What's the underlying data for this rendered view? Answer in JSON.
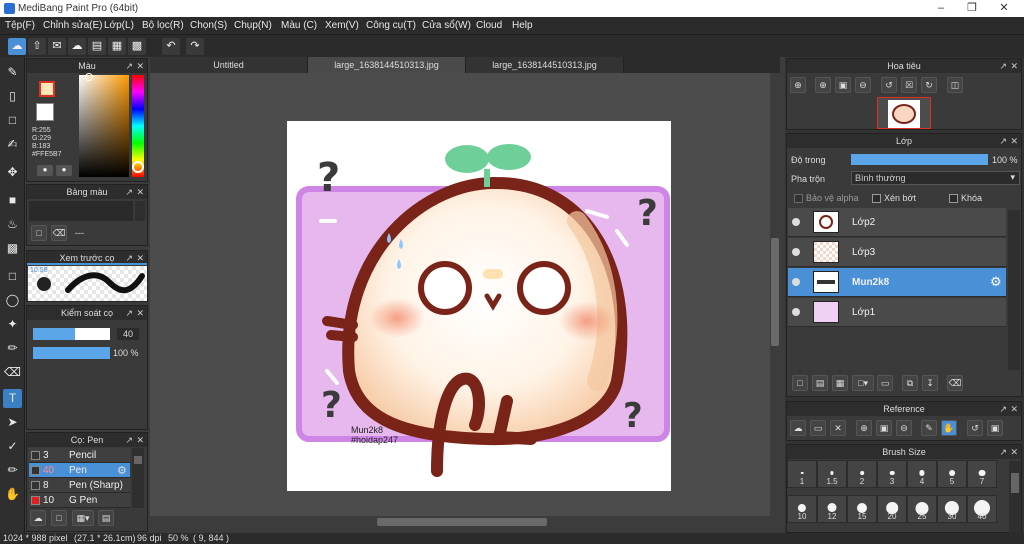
{
  "window": {
    "title": "MediBang Paint Pro (64bit)",
    "min_icon": "minimize-icon",
    "max_icon": "maximize-icon",
    "close_icon": "close-icon"
  },
  "menu": [
    "Tệp(F)",
    "Chỉnh sửa(E)",
    "Lớp(L)",
    "Bộ lọc(R)",
    "Chọn(S)",
    "Chụp(N)",
    "Màu (C)",
    "Xem(V)",
    "Công cụ(T)",
    "Cửa sổ(W)",
    "Cloud",
    "Help"
  ],
  "tabs": [
    {
      "label": "Untitled",
      "active": false
    },
    {
      "label": "large_1638144510313.jpg",
      "active": true
    },
    {
      "label": "large_1638144510313.jpg",
      "active": false
    }
  ],
  "color_panel": {
    "title": "Màu",
    "r": "R:255",
    "g": "G:229",
    "b": "B:183",
    "hex": "#FFE5B7",
    "fg_color": "#FFE5B7",
    "bg_color": "#FFFFFF"
  },
  "palette_panel": {
    "title": "Bảng màu",
    "dash": "---"
  },
  "brush_preview_panel": {
    "title": "Xem trước cọ",
    "size": "10.58"
  },
  "brush_control_panel": {
    "title": "Kiểm soát cọ",
    "size_value": "40",
    "opacity_value": "100 %",
    "size_fraction": 0.55,
    "opacity_fraction": 1.0
  },
  "brush_list_panel": {
    "title": "Cọ: Pen",
    "items": [
      {
        "num": "3",
        "name": "Pencil",
        "color": "#333333",
        "selected": false
      },
      {
        "num": "40",
        "name": "Pen",
        "color": "#333333",
        "selected": true
      },
      {
        "num": "8",
        "name": "Pen (Sharp)",
        "color": "#333333",
        "selected": false
      },
      {
        "num": "10",
        "name": "G Pen",
        "color": "#e02020",
        "selected": false
      }
    ]
  },
  "canvas": {
    "signature_line1": "Mun2k8",
    "signature_line2": "#hoidap247"
  },
  "navigator": {
    "title": "Hoa tiêu"
  },
  "layers_panel": {
    "title": "Lớp",
    "opacity_label": "Độ trong",
    "opacity_value": "100 %",
    "blend_label": "Pha trộn",
    "blend_value": "Bình thường",
    "protect_alpha": "Bảo vệ alpha",
    "clipping": "Xén bớt",
    "lock": "Khóa",
    "layers": [
      {
        "name": "Lớp2",
        "selected": false
      },
      {
        "name": "Lớp3",
        "selected": false
      },
      {
        "name": "Mun2k8",
        "selected": true
      },
      {
        "name": "Lớp1",
        "selected": false
      }
    ]
  },
  "reference_panel": {
    "title": "Reference"
  },
  "brush_size_panel": {
    "title": "Brush Size",
    "sizes": [
      "1",
      "1.5",
      "2",
      "3",
      "4",
      "5",
      "7",
      "10",
      "12",
      "15",
      "20",
      "25",
      "30",
      "40"
    ]
  },
  "status": {
    "dims": "1024 * 988 pixel",
    "cm": "(27.1 * 26.1cm)",
    "dpi": "96 dpi",
    "zoom": "50 %",
    "coords": "( 9, 844 )"
  }
}
